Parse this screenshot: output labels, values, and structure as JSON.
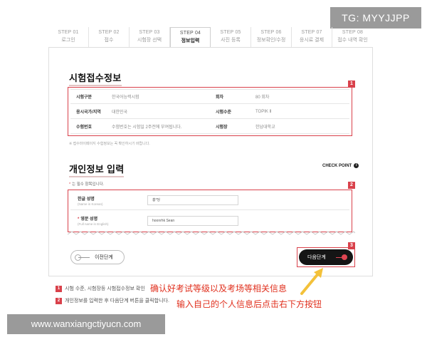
{
  "watermarks": {
    "tg": "TG: MYYJJPP",
    "url": "www.wanxiangctiyucn.com"
  },
  "steps": [
    {
      "num": "STEP 01",
      "label": "로그인",
      "active": false
    },
    {
      "num": "STEP 02",
      "label": "접수",
      "active": false
    },
    {
      "num": "STEP 03",
      "label": "시험장 선택",
      "active": false
    },
    {
      "num": "STEP 04",
      "label": "정보입력",
      "active": true
    },
    {
      "num": "STEP 05",
      "label": "사진 등록",
      "active": false
    },
    {
      "num": "STEP 06",
      "label": "정보확인/수정",
      "active": false
    },
    {
      "num": "STEP 07",
      "label": "응시료 결제",
      "active": false
    },
    {
      "num": "STEP 08",
      "label": "접수 내역 확인",
      "active": false
    }
  ],
  "exam_info": {
    "title": "시험접수정보",
    "badge": "1",
    "rows": [
      {
        "k1": "시험구분",
        "v1": "한국어능력시험",
        "k2": "회차",
        "v2": "80 회차"
      },
      {
        "k1": "응시국가/지역",
        "v1": "대한민국",
        "k2": "시험수준",
        "v2": "TOPIK Ⅱ"
      },
      {
        "k1": "수험번호",
        "v1": "수험번호는 시험일 2주전에 부여됩니다.",
        "k2": "시험장",
        "v2": "한남대학교"
      }
    ],
    "note": "※ 접수마이페이지 수험정보는 꼭 확인하시기 바랍니다."
  },
  "personal_info": {
    "title": "개인정보 입력",
    "checkpoint": "CHECK POINT",
    "checkpoint_icon": "info-icon",
    "required_note": "는 필수 항목입니다.",
    "badge": "2",
    "fields": [
      {
        "label": "한글 성명",
        "sub": "(Name in Korean)",
        "required": false,
        "value": "홍*당"
      },
      {
        "label": "영문 성명",
        "sub": "(Full name in English)",
        "required": true,
        "value": "hoonrhk Sean"
      }
    ]
  },
  "buttons": {
    "prev": "이전단계",
    "next": "다음단계",
    "next_badge": "3"
  },
  "legend": [
    {
      "badge": "1",
      "text": "시험 수준, 시험장등 시험접수정보 확인"
    },
    {
      "badge": "2",
      "text": "개인정보를 입력한 후 다음단계 버튼을 클릭합니다."
    }
  ],
  "annotations": {
    "cn1": "确认好考试等级以及考场等相关信息",
    "cn2": "输入自己的个人信息后点击右下方按钮"
  },
  "colors": {
    "accent_red": "#d9414b",
    "annotation_red": "#e0301e",
    "arrow_yellow": "#f3c13a",
    "button_dark": "#151515"
  }
}
